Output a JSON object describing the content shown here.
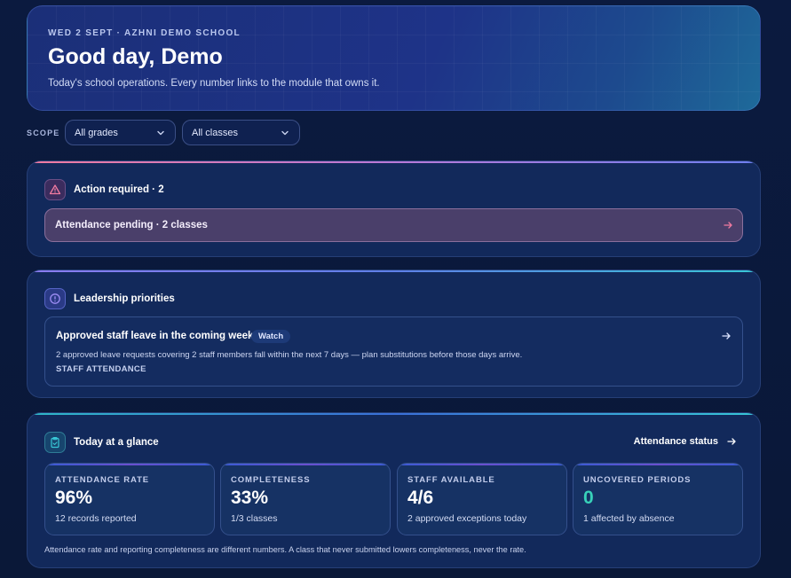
{
  "header": {
    "date_line": "WED 2 SEPT · AZHNI DEMO SCHOOL",
    "greeting": "Good day, Demo",
    "subtitle": "Today's school operations. Every number links to the module that owns it."
  },
  "scope": {
    "label": "SCOPE",
    "grade_select": "All grades",
    "class_select": "All classes"
  },
  "action_required": {
    "title": "Action required · 2",
    "items": [
      {
        "label": "Attendance pending · 2 classes"
      }
    ],
    "accent_color": "#f07aa0"
  },
  "leadership": {
    "title": "Leadership priorities",
    "priorities": [
      {
        "title": "Approved staff leave in the coming week",
        "badge": "Watch",
        "description": "2 approved leave requests covering 2 staff members fall within the next 7 days — plan substitutions before those days arrive.",
        "module": "STAFF ATTENDANCE"
      }
    ]
  },
  "glance": {
    "title": "Today at a glance",
    "link": "Attendance status",
    "tiles": [
      {
        "label": "ATTENDANCE RATE",
        "value": "96%",
        "sub": "12 records reported"
      },
      {
        "label": "COMPLETENESS",
        "value": "33%",
        "sub": "1/3 classes"
      },
      {
        "label": "STAFF AVAILABLE",
        "value": "4/6",
        "sub": "2 approved exceptions today"
      },
      {
        "label": "UNCOVERED PERIODS",
        "value": "0",
        "sub": "1 affected by absence"
      }
    ],
    "footnote": "Attendance rate and reporting completeness are different numbers. A class that never submitted lowers completeness, never the rate."
  },
  "colors": {
    "background": "#0b1a3f",
    "card": "#12295b",
    "accent_pink": "#f07aa0",
    "accent_purple": "#8b7cf0",
    "accent_teal": "#38d1b9"
  }
}
